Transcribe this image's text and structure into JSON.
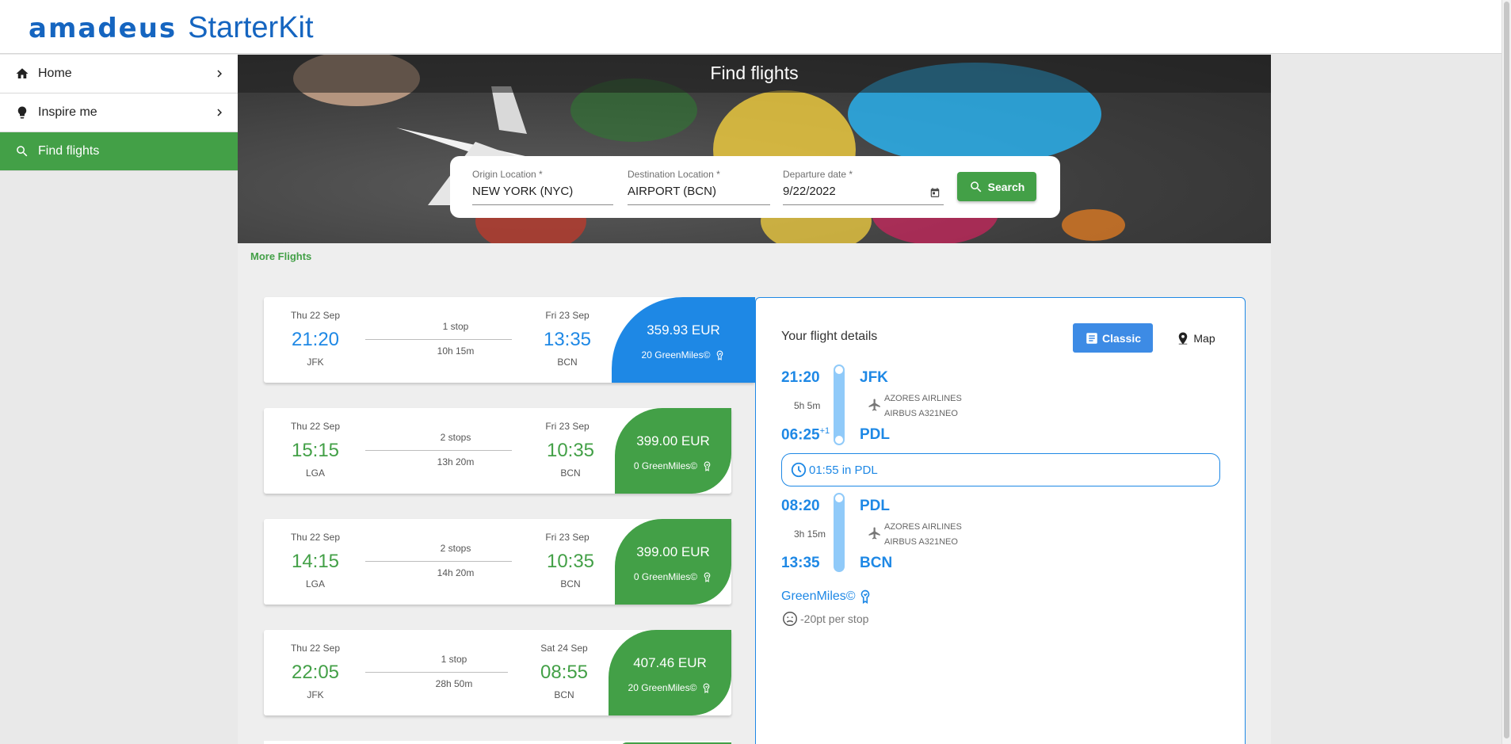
{
  "header": {
    "brand": "amadeus",
    "product": "StarterKit"
  },
  "sidebar": {
    "items": [
      {
        "label": "Home",
        "icon": "home-icon",
        "active": false
      },
      {
        "label": "Inspire me",
        "icon": "lightbulb-icon",
        "active": false
      },
      {
        "label": "Find flights",
        "icon": "search-icon",
        "active": true
      }
    ]
  },
  "hero": {
    "title": "Find flights"
  },
  "search": {
    "origin": {
      "label": "Origin Location *",
      "value": "NEW YORK (NYC)"
    },
    "destination": {
      "label": "Destination Location *",
      "value": "AIRPORT (BCN)"
    },
    "date": {
      "label": "Departure date *",
      "value": "9/22/2022"
    },
    "button_label": "Search"
  },
  "more_flights": "More Flights",
  "colors": {
    "green": "#43a047",
    "blue": "#1e88e5",
    "selected": "#1e88e5"
  },
  "flights": [
    {
      "dep_date": "Thu 22 Sep",
      "dep_time": "21:20",
      "dep_code": "JFK",
      "stops": "1 stop",
      "duration": "10h 15m",
      "arr_date": "Fri 23 Sep",
      "arr_time": "13:35",
      "arr_code": "BCN",
      "price": "359.93 EUR",
      "greenmiles": "20 GreenMiles©",
      "selected": true
    },
    {
      "dep_date": "Thu 22 Sep",
      "dep_time": "15:15",
      "dep_code": "LGA",
      "stops": "2 stops",
      "duration": "13h 20m",
      "arr_date": "Fri 23 Sep",
      "arr_time": "10:35",
      "arr_code": "BCN",
      "price": "399.00 EUR",
      "greenmiles": "0 GreenMiles©",
      "selected": false
    },
    {
      "dep_date": "Thu 22 Sep",
      "dep_time": "14:15",
      "dep_code": "LGA",
      "stops": "2 stops",
      "duration": "14h 20m",
      "arr_date": "Fri 23 Sep",
      "arr_time": "10:35",
      "arr_code": "BCN",
      "price": "399.00 EUR",
      "greenmiles": "0 GreenMiles©",
      "selected": false
    },
    {
      "dep_date": "Thu 22 Sep",
      "dep_time": "22:05",
      "dep_code": "JFK",
      "stops": "1 stop",
      "duration": "28h 50m",
      "arr_date": "Sat 24 Sep",
      "arr_time": "08:55",
      "arr_code": "BCN",
      "price": "407.46 EUR",
      "greenmiles": "20 GreenMiles©",
      "selected": false
    }
  ],
  "details": {
    "title": "Your flight details",
    "classic_label": "Classic",
    "map_label": "Map",
    "segments": [
      {
        "dep_time": "21:20",
        "dep_code": "JFK",
        "duration": "5h 5m",
        "airline": "AZORES AIRLINES",
        "aircraft": "AIRBUS A321NEO",
        "arr_time": "06:25",
        "arr_offset": "+1",
        "arr_code": "PDL"
      },
      {
        "dep_time": "08:20",
        "dep_code": "PDL",
        "duration": "3h 15m",
        "airline": "AZORES AIRLINES",
        "aircraft": "AIRBUS A321NEO",
        "arr_time": "13:35",
        "arr_code": "BCN"
      }
    ],
    "layover": "01:55 in PDL",
    "greenmiles_label": "GreenMiles©",
    "greenmiles_note": "-20pt per stop"
  }
}
